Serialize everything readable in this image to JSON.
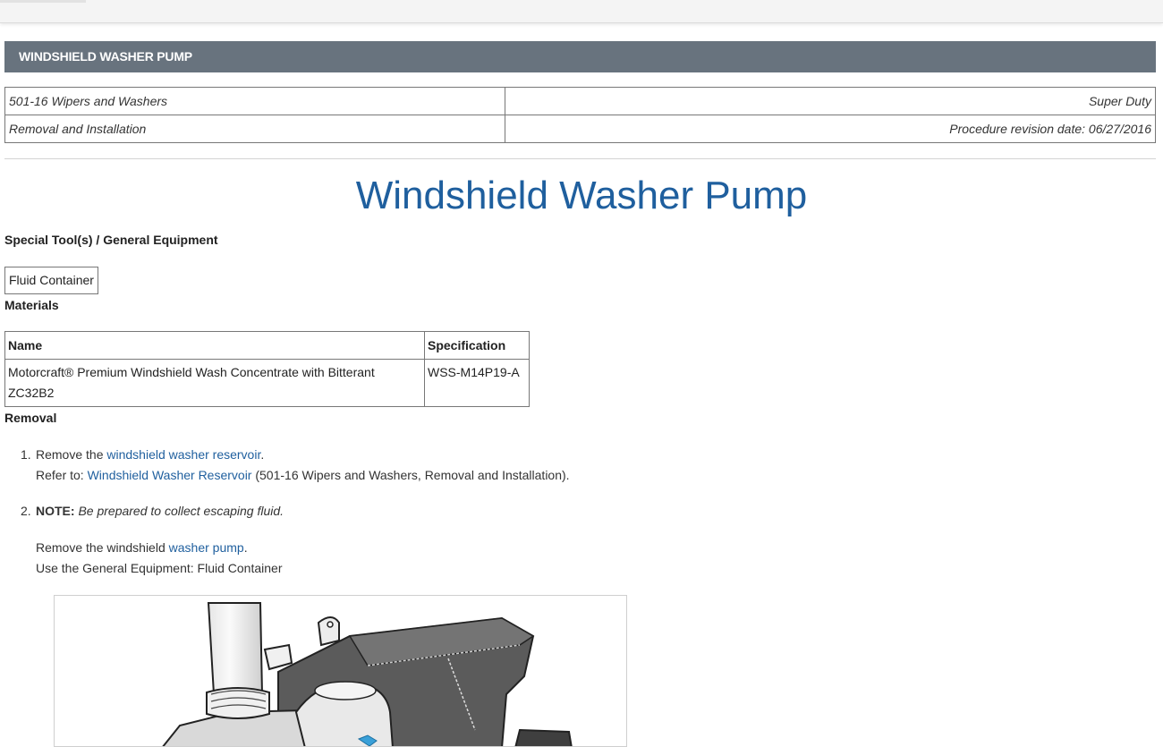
{
  "banner": {
    "title": "WINDSHIELD WASHER PUMP"
  },
  "info": {
    "section": "501-16 Wipers and Washers",
    "vehicle": "Super Duty",
    "procedure_type": "Removal and Installation",
    "revision": "Procedure revision date: 06/27/2016"
  },
  "page_title": "Windshield Washer Pump",
  "tools": {
    "heading": "Special Tool(s) / General Equipment",
    "items": [
      "Fluid Container"
    ]
  },
  "materials": {
    "heading": "Materials",
    "columns": [
      "Name",
      "Specification"
    ],
    "rows": [
      {
        "name": "Motorcraft® Premium Windshield Wash Concentrate with Bitterant ZC32B2",
        "spec": "WSS-M14P19-A"
      }
    ]
  },
  "removal": {
    "heading": "Removal",
    "steps": [
      {
        "num": "1.",
        "prefix": "Remove the ",
        "link": "windshield washer reservoir",
        "suffix": ".",
        "refer_prefix": "Refer to: ",
        "refer_link": "Windshield Washer Reservoir",
        "refer_suffix": " (501-16 Wipers and Washers, Removal and Installation)."
      },
      {
        "num": "2.",
        "note_label": "NOTE:",
        "note_text": "Be prepared to collect escaping fluid.",
        "line1_prefix": "Remove the windshield ",
        "line1_link": "washer pump",
        "line1_suffix": ".",
        "line2": "Use the General Equipment: Fluid Container"
      }
    ]
  }
}
